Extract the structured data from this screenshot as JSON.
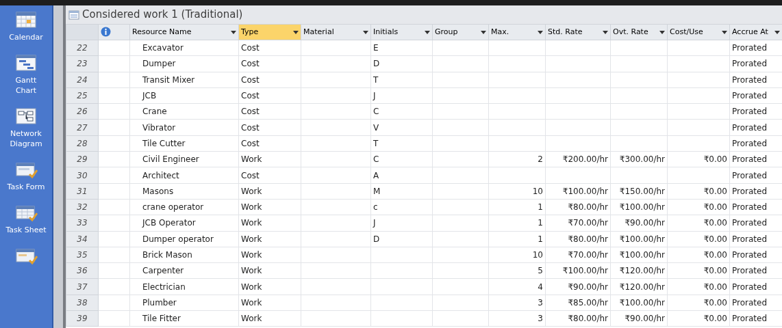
{
  "sidebar": {
    "items": [
      {
        "label": "Calendar"
      },
      {
        "label": "Gantt Chart"
      },
      {
        "label": "Network Diagram"
      },
      {
        "label": "Task Form"
      },
      {
        "label": "Task Sheet"
      }
    ]
  },
  "view": {
    "title": "Considered work 1 (Traditional)"
  },
  "table": {
    "columns": [
      {
        "kind": "id"
      },
      {
        "kind": "indicator"
      },
      {
        "label": "Resource Name",
        "selected": false
      },
      {
        "label": "Type",
        "selected": true
      },
      {
        "label": "Material",
        "selected": false
      },
      {
        "label": "Initials",
        "selected": false
      },
      {
        "label": "Group",
        "selected": false
      },
      {
        "label": "Max.",
        "selected": false
      },
      {
        "label": "Std. Rate",
        "selected": false
      },
      {
        "label": "Ovt. Rate",
        "selected": false
      },
      {
        "label": "Cost/Use",
        "selected": false
      },
      {
        "label": "Accrue At",
        "selected": false
      }
    ],
    "rows": [
      [
        "22",
        "",
        "Excavator",
        "Cost",
        "",
        "E",
        "",
        "",
        "",
        "",
        "",
        "Prorated"
      ],
      [
        "23",
        "",
        "Dumper",
        "Cost",
        "",
        "D",
        "",
        "",
        "",
        "",
        "",
        "Prorated"
      ],
      [
        "24",
        "",
        "Transit Mixer",
        "Cost",
        "",
        "T",
        "",
        "",
        "",
        "",
        "",
        "Prorated"
      ],
      [
        "25",
        "",
        "JCB",
        "Cost",
        "",
        "J",
        "",
        "",
        "",
        "",
        "",
        "Prorated"
      ],
      [
        "26",
        "",
        "Crane",
        "Cost",
        "",
        "C",
        "",
        "",
        "",
        "",
        "",
        "Prorated"
      ],
      [
        "27",
        "",
        "Vibrator",
        "Cost",
        "",
        "V",
        "",
        "",
        "",
        "",
        "",
        "Prorated"
      ],
      [
        "28",
        "",
        "Tile Cutter",
        "Cost",
        "",
        "T",
        "",
        "",
        "",
        "",
        "",
        "Prorated"
      ],
      [
        "29",
        "",
        "Civil Engineer",
        "Work",
        "",
        "C",
        "",
        "2",
        "₹200.00/hr",
        "₹300.00/hr",
        "₹0.00",
        "Prorated"
      ],
      [
        "30",
        "",
        "Architect",
        "Cost",
        "",
        "A",
        "",
        "",
        "",
        "",
        "",
        "Prorated"
      ],
      [
        "31",
        "",
        "Masons",
        "Work",
        "",
        "M",
        "",
        "10",
        "₹100.00/hr",
        "₹150.00/hr",
        "₹0.00",
        "Prorated"
      ],
      [
        "32",
        "",
        "crane operator",
        "Work",
        "",
        "c",
        "",
        "1",
        "₹80.00/hr",
        "₹100.00/hr",
        "₹0.00",
        "Prorated"
      ],
      [
        "33",
        "",
        "JCB Operator",
        "Work",
        "",
        "J",
        "",
        "1",
        "₹70.00/hr",
        "₹90.00/hr",
        "₹0.00",
        "Prorated"
      ],
      [
        "34",
        "",
        "Dumper operator",
        "Work",
        "",
        "D",
        "",
        "1",
        "₹80.00/hr",
        "₹100.00/hr",
        "₹0.00",
        "Prorated"
      ],
      [
        "35",
        "",
        "Brick Mason",
        "Work",
        "",
        "",
        "",
        "10",
        "₹70.00/hr",
        "₹100.00/hr",
        "₹0.00",
        "Prorated"
      ],
      [
        "36",
        "",
        "Carpenter",
        "Work",
        "",
        "",
        "",
        "5",
        "₹100.00/hr",
        "₹120.00/hr",
        "₹0.00",
        "Prorated"
      ],
      [
        "37",
        "",
        "Electrician",
        "Work",
        "",
        "",
        "",
        "4",
        "₹90.00/hr",
        "₹120.00/hr",
        "₹0.00",
        "Prorated"
      ],
      [
        "38",
        "",
        "Plumber",
        "Work",
        "",
        "",
        "",
        "3",
        "₹85.00/hr",
        "₹100.00/hr",
        "₹0.00",
        "Prorated"
      ],
      [
        "39",
        "",
        "Tile Fitter",
        "Work",
        "",
        "",
        "",
        "3",
        "₹80.00/hr",
        "₹90.00/hr",
        "₹0.00",
        "Prorated"
      ]
    ]
  }
}
